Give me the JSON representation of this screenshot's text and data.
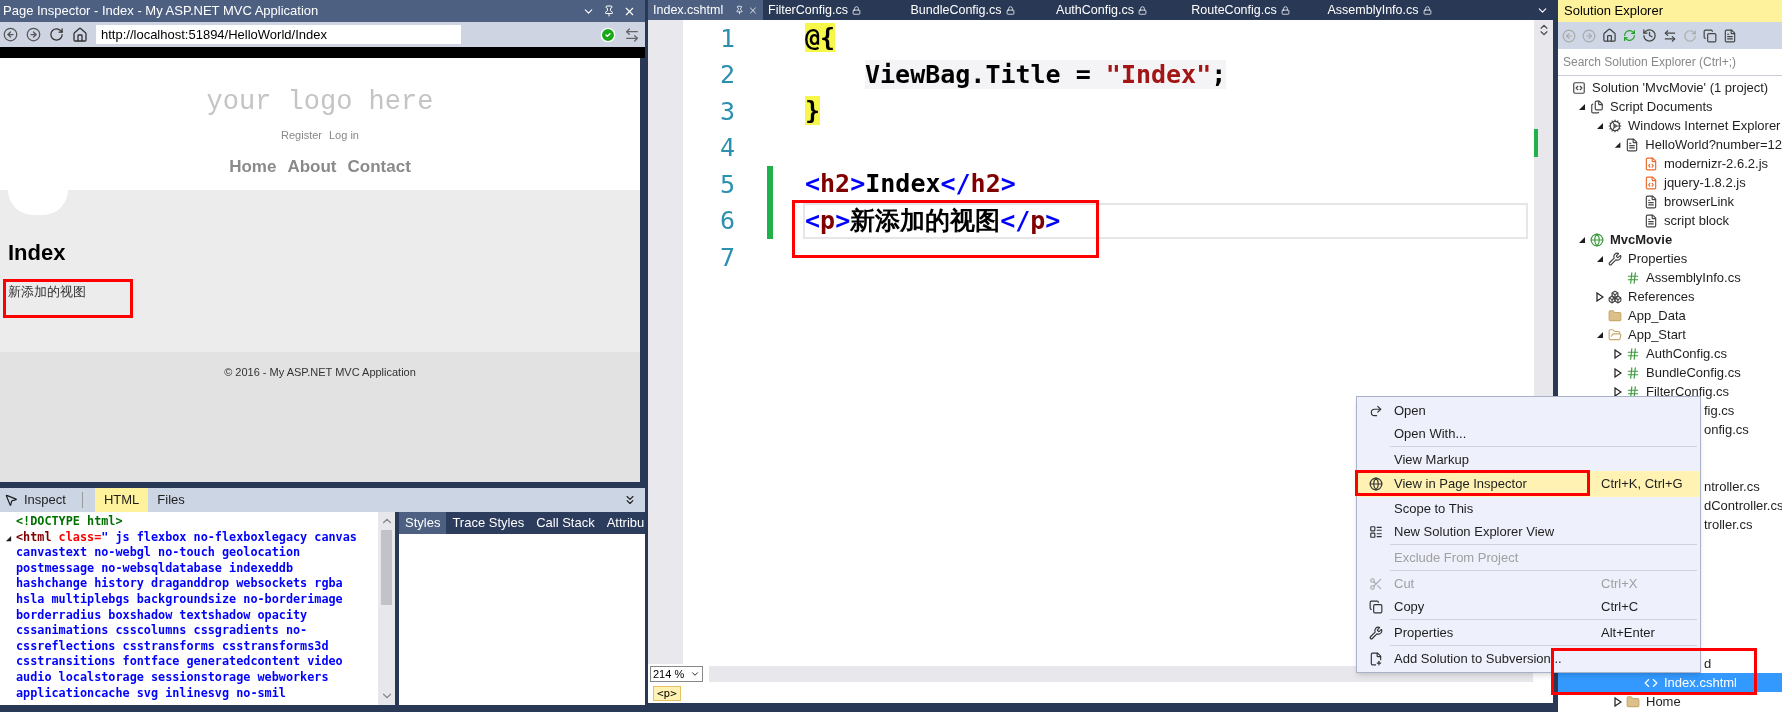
{
  "inspector": {
    "title": "Page Inspector - Index - My ASP.NET MVC Application",
    "url": "http://localhost:51894/HelloWorld/Index",
    "page": {
      "logo": "your logo here",
      "account_links": [
        "Register",
        "Log in"
      ],
      "nav": [
        "Home",
        "About",
        "Contact"
      ],
      "heading": "Index",
      "paragraph": "新添加的视图",
      "footer": "© 2016 - My ASP.NET MVC Application"
    },
    "tools": {
      "inspect": "Inspect",
      "tabs": [
        {
          "label": "HTML",
          "selected": true
        },
        {
          "label": "Files",
          "selected": false
        }
      ]
    },
    "html_lines": [
      {
        "expander": false,
        "tokens": [
          {
            "kind": "doctype",
            "text": "<!DOCTYPE html>"
          }
        ]
      },
      {
        "expander": true,
        "tokens": [
          {
            "kind": "tag",
            "text": "<html"
          },
          {
            "kind": "attr",
            "text": " class="
          },
          {
            "kind": "value",
            "text": "\" js flexbox no-flexboxlegacy canvas"
          }
        ]
      },
      {
        "expander": false,
        "tokens": [
          {
            "kind": "value",
            "text": "canvastext no-webgl no-touch geolocation"
          }
        ]
      },
      {
        "expander": false,
        "tokens": [
          {
            "kind": "value",
            "text": "postmessage no-websqldatabase indexeddb"
          }
        ]
      },
      {
        "expander": false,
        "tokens": [
          {
            "kind": "value",
            "text": "hashchange history draganddrop websockets rgba"
          }
        ]
      },
      {
        "expander": false,
        "tokens": [
          {
            "kind": "value",
            "text": "hsla multiplebgs backgroundsize no-borderimage"
          }
        ]
      },
      {
        "expander": false,
        "tokens": [
          {
            "kind": "value",
            "text": "borderradius boxshadow textshadow opacity"
          }
        ]
      },
      {
        "expander": false,
        "tokens": [
          {
            "kind": "value",
            "text": "cssanimations csscolumns cssgradients no-"
          }
        ]
      },
      {
        "expander": false,
        "tokens": [
          {
            "kind": "value",
            "text": "cssreflections csstransforms csstransforms3d"
          }
        ]
      },
      {
        "expander": false,
        "tokens": [
          {
            "kind": "value",
            "text": "csstransitions fontface generatedcontent video"
          }
        ]
      },
      {
        "expander": false,
        "tokens": [
          {
            "kind": "value",
            "text": "audio localstorage sessionstorage webworkers"
          }
        ]
      },
      {
        "expander": false,
        "tokens": [
          {
            "kind": "value",
            "text": "applicationcache svg inlinesvg no-smil"
          }
        ]
      }
    ],
    "side_tabs": [
      {
        "label": "Styles",
        "selected": true
      },
      {
        "label": "Trace Styles",
        "selected": false
      },
      {
        "label": "Call Stack",
        "selected": false
      },
      {
        "label": "Attribu",
        "selected": false
      }
    ]
  },
  "editor": {
    "tabs": [
      {
        "label": "Index.cshtml",
        "selected": true
      },
      {
        "label": "FilterConfig.cs",
        "selected": false
      },
      {
        "label": "BundleConfig.cs",
        "selected": false
      },
      {
        "label": "AuthConfig.cs",
        "selected": false
      },
      {
        "label": "RouteConfig.cs",
        "selected": false
      },
      {
        "label": "AssemblyInfo.cs",
        "selected": false
      }
    ],
    "lines": [
      {
        "number": "1",
        "changed": false,
        "current": false,
        "tokens": [
          {
            "kind": "razor",
            "text": "@{"
          }
        ]
      },
      {
        "number": "2",
        "changed": false,
        "current": false,
        "tokens": [
          {
            "kind": "csharp",
            "text": "ViewBag.Title = "
          },
          {
            "kind": "csharp-string",
            "text": "\"Index\""
          },
          {
            "kind": "csharp",
            "text": ";"
          }
        ]
      },
      {
        "number": "3",
        "changed": false,
        "current": false,
        "tokens": [
          {
            "kind": "razor",
            "text": "}"
          }
        ]
      },
      {
        "number": "4",
        "changed": false,
        "current": false
      },
      {
        "number": "5",
        "changed": true,
        "current": false,
        "tokens": [
          {
            "kind": "bracket",
            "text": "<"
          },
          {
            "kind": "tag",
            "text": "h2"
          },
          {
            "kind": "bracket",
            "text": ">"
          },
          {
            "kind": "plain",
            "text": "Index"
          },
          {
            "kind": "bracket",
            "text": "</"
          },
          {
            "kind": "tag",
            "text": "h2"
          },
          {
            "kind": "bracket",
            "text": ">"
          }
        ]
      },
      {
        "number": "6",
        "changed": true,
        "current": true,
        "tokens": [
          {
            "kind": "bracket",
            "text": "<"
          },
          {
            "kind": "tag",
            "text": "p"
          },
          {
            "kind": "bracket",
            "text": ">"
          },
          {
            "kind": "plain",
            "text": "新添加的视图"
          },
          {
            "kind": "bracket",
            "text": "</"
          },
          {
            "kind": "tag",
            "text": "p"
          },
          {
            "kind": "bracket",
            "text": ">"
          }
        ]
      },
      {
        "number": "7",
        "changed": false,
        "current": false
      }
    ],
    "zoom": "214 %",
    "breadcrumb": "<p>"
  },
  "solution_explorer": {
    "title": "Solution Explorer",
    "search": {
      "placeholder": "Search Solution Explorer (Ctrl+;)"
    },
    "tree": [
      {
        "label": "Solution 'MvcMovie' (1 project)",
        "kind": "solution",
        "bold": false,
        "selected": false,
        "children": [
          {
            "label": "Script Documents",
            "kind": "script-docs",
            "expanded": true,
            "bold": false,
            "selected": false,
            "children": [
              {
                "label": "Windows Internet Explorer",
                "kind": "gears",
                "expanded": true,
                "bold": false,
                "selected": false,
                "children": [
                  {
                    "label": "HelloWorld?number=12",
                    "kind": "page",
                    "expanded": true,
                    "bold": false,
                    "selected": false,
                    "children": [
                      {
                        "label": "modernizr-2.6.2.js",
                        "kind": "js",
                        "bold": false,
                        "selected": false
                      },
                      {
                        "label": "jquery-1.8.2.js",
                        "kind": "js",
                        "bold": false,
                        "selected": false
                      },
                      {
                        "label": "browserLink",
                        "kind": "page",
                        "bold": false,
                        "selected": false
                      },
                      {
                        "label": "script block",
                        "kind": "page",
                        "bold": false,
                        "selected": false
                      }
                    ]
                  }
                ]
              }
            ]
          },
          {
            "label": "MvcMovie",
            "kind": "project",
            "expanded": true,
            "bold": true,
            "selected": false,
            "children": [
              {
                "label": "Properties",
                "kind": "wrench",
                "expanded": true,
                "bold": false,
                "selected": false,
                "children": [
                  {
                    "label": "AssemblyInfo.cs",
                    "kind": "csharp",
                    "bold": false,
                    "selected": false
                  }
                ]
              },
              {
                "label": "References",
                "kind": "references",
                "expanded": false,
                "bold": false,
                "selected": false
              },
              {
                "label": "App_Data",
                "kind": "folder",
                "bold": false,
                "selected": false
              },
              {
                "label": "App_Start",
                "kind": "folder-open",
                "expanded": true,
                "bold": false,
                "selected": false,
                "children": [
                  {
                    "label": "AuthConfig.cs",
                    "kind": "csharp",
                    "expanded": false,
                    "bold": false,
                    "selected": false
                  },
                  {
                    "label": "BundleConfig.cs",
                    "kind": "csharp",
                    "expanded": false,
                    "bold": false,
                    "selected": false
                  },
                  {
                    "label": "FilterConfig.cs",
                    "kind": "csharp",
                    "expanded": false,
                    "bold": false,
                    "selected": false
                  }
                ]
              }
            ]
          }
        ]
      }
    ],
    "lower_rows": [
      {
        "label": "fig.cs",
        "covered": true,
        "selected": false
      },
      {
        "label": "onfig.cs",
        "covered": true,
        "selected": false
      },
      {
        "label": "ntroller.cs",
        "covered": true,
        "selected": false
      },
      {
        "label": "dController.cs",
        "covered": true,
        "selected": false
      },
      {
        "label": "troller.cs",
        "covered": true,
        "selected": false
      },
      {
        "label": "d",
        "covered": true,
        "selected": false,
        "children": [
          {
            "label": "Index.cshtml",
            "kind": "cshtml",
            "covered": false,
            "selected": true
          }
        ]
      },
      {
        "label": "Home",
        "kind": "folder",
        "expanded": false,
        "covered": false,
        "selected": false
      }
    ]
  },
  "context_menu": {
    "items": [
      {
        "kind": "item",
        "label": "Open",
        "disabled": false,
        "highlighted": false
      },
      {
        "kind": "item",
        "label": "Open With...",
        "disabled": false,
        "highlighted": false
      },
      {
        "kind": "separator"
      },
      {
        "kind": "item",
        "label": "View Markup",
        "disabled": false,
        "highlighted": false
      },
      {
        "kind": "item",
        "label": "View in Page Inspector",
        "shortcut": "Ctrl+K, Ctrl+G",
        "disabled": false,
        "highlighted": true
      },
      {
        "kind": "item",
        "label": "Scope to This",
        "disabled": false,
        "highlighted": false
      },
      {
        "kind": "item",
        "label": "New Solution Explorer View",
        "disabled": false,
        "highlighted": false
      },
      {
        "kind": "separator"
      },
      {
        "kind": "item",
        "label": "Exclude From Project",
        "disabled": true,
        "highlighted": false
      },
      {
        "kind": "separator"
      },
      {
        "kind": "item",
        "label": "Cut",
        "shortcut": "Ctrl+X",
        "disabled": true,
        "highlighted": false
      },
      {
        "kind": "item",
        "label": "Copy",
        "shortcut": "Ctrl+C",
        "disabled": false,
        "highlighted": false
      },
      {
        "kind": "separator"
      },
      {
        "kind": "item",
        "label": "Properties",
        "shortcut": "Alt+Enter",
        "disabled": false,
        "highlighted": false
      },
      {
        "kind": "separator"
      },
      {
        "kind": "item",
        "label": "Add Solution to Subversion...",
        "disabled": false,
        "highlighted": false
      }
    ]
  }
}
